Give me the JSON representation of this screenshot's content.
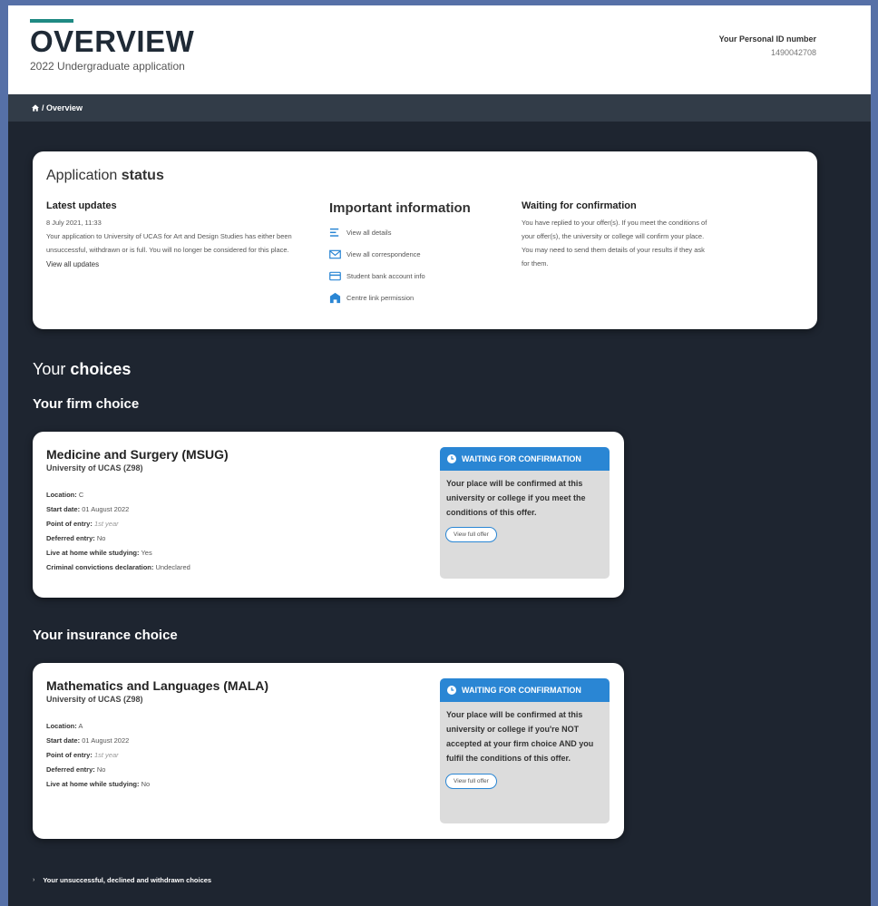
{
  "header": {
    "title": "OVERVIEW",
    "subtitle": "2022 Undergraduate application",
    "personal_id_label": "Your Personal ID number",
    "personal_id_value": "1490042708"
  },
  "breadcrumb": {
    "text": "/ Overview",
    "icon": "home-icon"
  },
  "application_status": {
    "heading_light": "Application ",
    "heading_bold": "status",
    "latest_updates": {
      "title": "Latest updates",
      "date": "8 July 2021, 11:33",
      "message": "Your application to University of UCAS for Art and Design Studies has either been unsuccessful, withdrawn or is full. You will no longer be considered for this place.",
      "link": "View all updates"
    },
    "important_information": {
      "title": "Important information",
      "links": [
        {
          "label": "View all details",
          "icon": "list-icon"
        },
        {
          "label": "View all correspondence",
          "icon": "envelope-icon"
        },
        {
          "label": "Student bank account info",
          "icon": "card-icon"
        },
        {
          "label": "Centre link permission",
          "icon": "building-icon"
        }
      ]
    },
    "waiting": {
      "title": "Waiting for confirmation",
      "message": "You have replied to your offer(s). If you meet the conditions of your offer(s), the university or college will confirm your place. You may need to send them details of your results if they ask for them."
    }
  },
  "choices": {
    "heading_light": "Your ",
    "heading_bold": "choices",
    "firm": {
      "section_title": "Your firm choice",
      "course": "Medicine and Surgery (MSUG)",
      "university": "University of UCAS (Z98)",
      "location_label": "Location:",
      "location": "C",
      "start_label": "Start date:",
      "start": "01 August 2022",
      "entry_label": "Point of entry:",
      "entry": "1st year",
      "deferred_label": "Deferred entry:",
      "deferred": "No",
      "home_label": "Live at home while studying:",
      "home": "Yes",
      "criminal_label": "Criminal convictions declaration:",
      "criminal": "Undeclared",
      "status": "WAITING FOR CONFIRMATION",
      "status_text": "Your place will be confirmed at this university or college if you meet the conditions of this offer.",
      "button": "View full offer"
    },
    "insurance": {
      "section_title": "Your insurance choice",
      "course": "Mathematics and Languages (MALA)",
      "university": "University of UCAS (Z98)",
      "location_label": "Location:",
      "location": "A",
      "start_label": "Start date:",
      "start": "01 August 2022",
      "entry_label": "Point of entry:",
      "entry": "1st year",
      "deferred_label": "Deferred entry:",
      "deferred": "No",
      "home_label": "Live at home while studying:",
      "home": "No",
      "status": "WAITING FOR CONFIRMATION",
      "status_text": "Your place will be confirmed at this university or college if you're NOT accepted at your firm choice AND you fulfil the conditions of this offer.",
      "button": "View full offer"
    }
  },
  "footer": {
    "link": "Your unsuccessful, declined and withdrawn choices"
  },
  "colors": {
    "accent": "#1f8a83",
    "status_blue": "#2a86d4",
    "background": "#1e2530"
  }
}
